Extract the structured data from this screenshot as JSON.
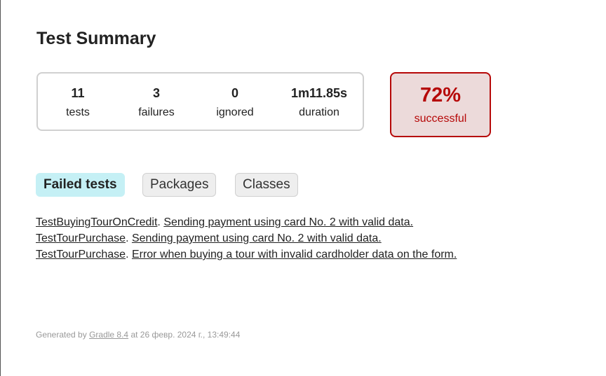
{
  "page": {
    "title": "Test Summary"
  },
  "summary": {
    "tests": {
      "value": "11",
      "label": "tests"
    },
    "failures": {
      "value": "3",
      "label": "failures"
    },
    "ignored": {
      "value": "0",
      "label": "ignored"
    },
    "duration": {
      "value": "1m11.85s",
      "label": "duration"
    }
  },
  "success": {
    "rate": "72%",
    "label": "successful",
    "color": "#b60808",
    "background": "#ecdada"
  },
  "tabs": [
    {
      "label": "Failed tests",
      "active": true
    },
    {
      "label": "Packages",
      "active": false
    },
    {
      "label": "Classes",
      "active": false
    }
  ],
  "failed_tests": [
    {
      "class": "TestBuyingTourOnCredit",
      "test": "Sending payment using card No. 2 with valid data."
    },
    {
      "class": "TestTourPurchase",
      "test": "Sending payment using card No. 2 with valid data."
    },
    {
      "class": "TestTourPurchase",
      "test": "Error when buying a tour with invalid cardholder data on the form."
    }
  ],
  "footer": {
    "prefix": "Generated by ",
    "link": "Gradle 8.4",
    "suffix": " at 26 февр. 2024 г., 13:49:44"
  }
}
